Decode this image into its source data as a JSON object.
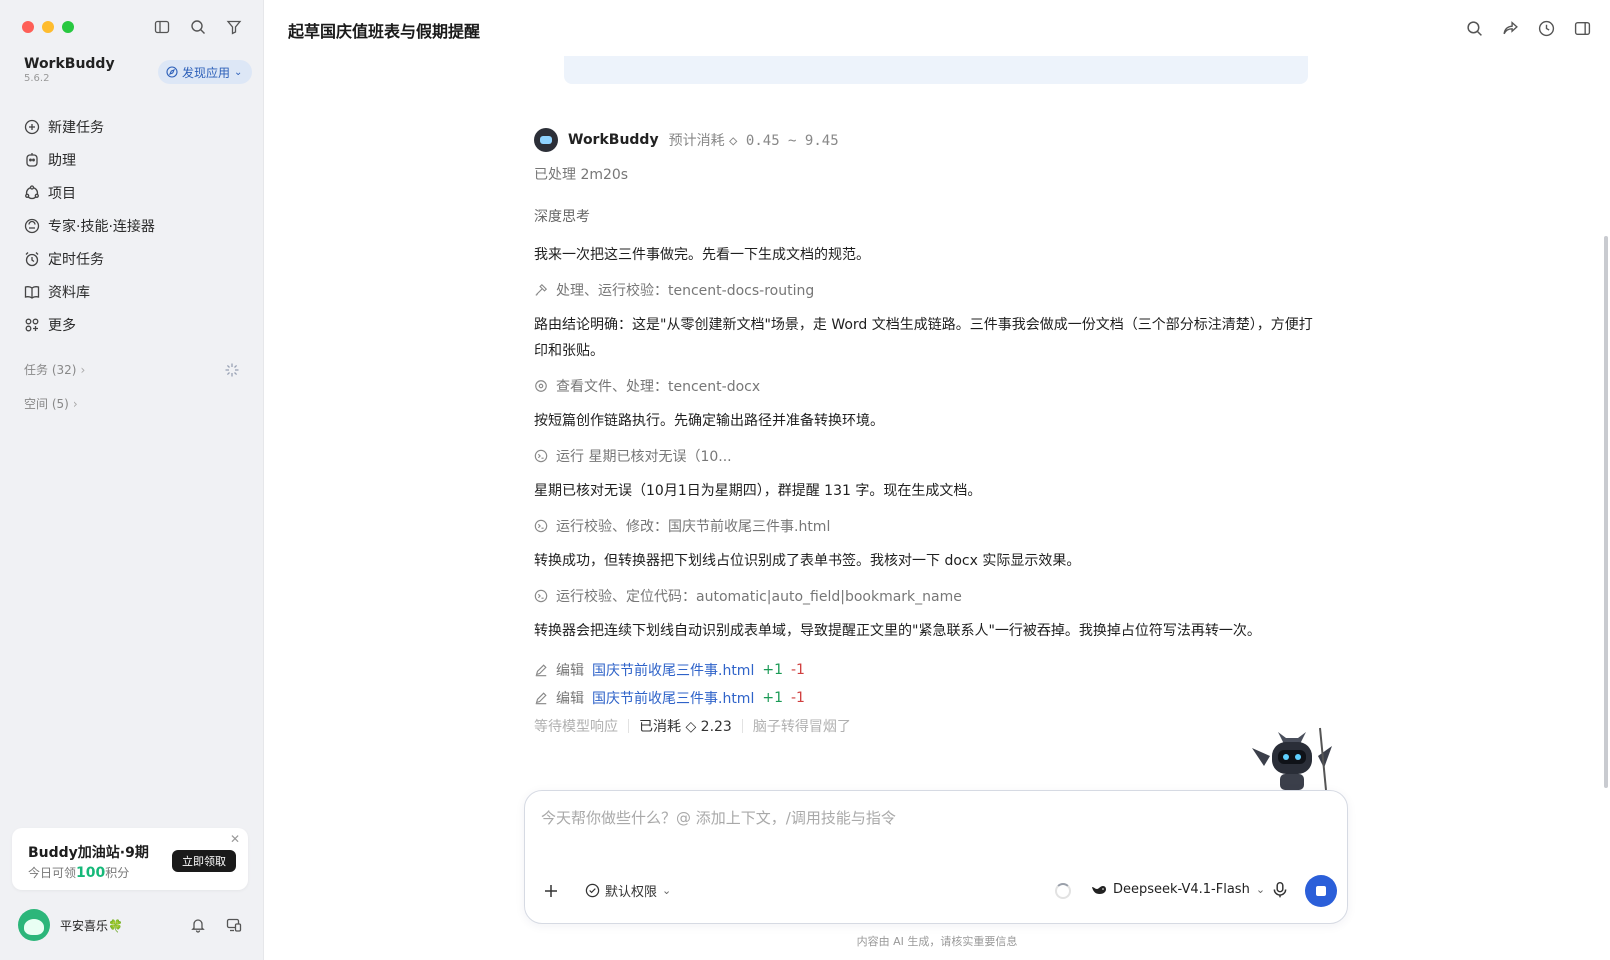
{
  "sidebar": {
    "brand_name": "WorkBuddy",
    "brand_version": "5.6.2",
    "discover_label": "发现应用",
    "nav": [
      {
        "label": "新建任务",
        "icon": "plus-circle-icon"
      },
      {
        "label": "助理",
        "icon": "assistant-icon"
      },
      {
        "label": "项目",
        "icon": "project-icon"
      },
      {
        "label": "专家·技能·连接器",
        "icon": "expert-skill-icon"
      },
      {
        "label": "定时任务",
        "icon": "alarm-clock-icon"
      },
      {
        "label": "资料库",
        "icon": "book-icon"
      },
      {
        "label": "更多",
        "icon": "grid-icon"
      }
    ],
    "tasks_label": "任务 (32)",
    "spaces_label": "空间 (5)",
    "promo": {
      "title": "Buddy加油站·9期",
      "sub_prefix": "今日可领",
      "sub_number": "100",
      "sub_suffix": "积分",
      "button": "立即领取",
      "close": "✕"
    },
    "user_name": "平安喜乐🍀"
  },
  "main": {
    "title": "起草国庆值班表与假期提醒",
    "message": {
      "bot_name": "WorkBuddy",
      "cost_label": "预计消耗",
      "cost_value": "◇ 0.45 ~ 9.45",
      "processed": "已处理 2m20s",
      "deep_thinking": "深度思考",
      "steps": [
        {
          "type": "text",
          "text": "我来一次把这三件事做完。先看一下生成文档的规范。"
        },
        {
          "type": "tool",
          "icon": "tool-icon",
          "text": "处理、运行校验：tencent-docs-routing"
        },
        {
          "type": "text",
          "text": "路由结论明确：这是\"从零创建新文档\"场景，走 Word 文档生成链路。三件事我会做成一份文档（三个部分标注清楚），方便打印和张贴。"
        },
        {
          "type": "tool",
          "icon": "eye-icon",
          "text": "查看文件、处理：tencent-docx"
        },
        {
          "type": "text",
          "text": "按短篇创作链路执行。先确定输出路径并准备转换环境。"
        },
        {
          "type": "tool",
          "icon": "terminal-icon",
          "text": "运行 星期已核对无误（10..."
        },
        {
          "type": "text",
          "text": "星期已核对无误（10月1日为星期四），群提醒 131 字。现在生成文档。"
        },
        {
          "type": "tool",
          "icon": "terminal-icon",
          "text": "运行校验、修改：国庆节前收尾三件事.html"
        },
        {
          "type": "text",
          "text": "转换成功，但转换器把下划线占位识别成了表单书签。我核对一下 docx 实际显示效果。"
        },
        {
          "type": "tool",
          "icon": "terminal-icon",
          "text": "运行校验、定位代码：automatic|auto_field|bookmark_name"
        },
        {
          "type": "text",
          "text": "转换器会把连续下划线自动识别成表单域，导致提醒正文里的\"紧急联系人\"一行被吞掉。我换掉占位符写法再转一次。"
        }
      ],
      "edits": [
        {
          "label": "编辑",
          "file": "国庆节前收尾三件事.html",
          "plus": "+1",
          "minus": "-1"
        },
        {
          "label": "编辑",
          "file": "国庆节前收尾三件事.html",
          "plus": "+1",
          "minus": "-1"
        }
      ],
      "status": {
        "waiting": "等待模型响应",
        "spent": "已消耗 ◇ 2.23",
        "mood": "脑子转得冒烟了"
      }
    },
    "composer": {
      "placeholder": "今天帮你做些什么？@ 添加上下文，/调用技能与指令",
      "permission": "默认权限",
      "model": "Deepseek-V4.1-Flash"
    },
    "footnote": "内容由 AI 生成，请核实重要信息"
  },
  "colors": {
    "accent": "#2b5fd9",
    "link": "#2f63c9",
    "diff_plus": "#1a9a55",
    "diff_minus": "#d04040"
  }
}
